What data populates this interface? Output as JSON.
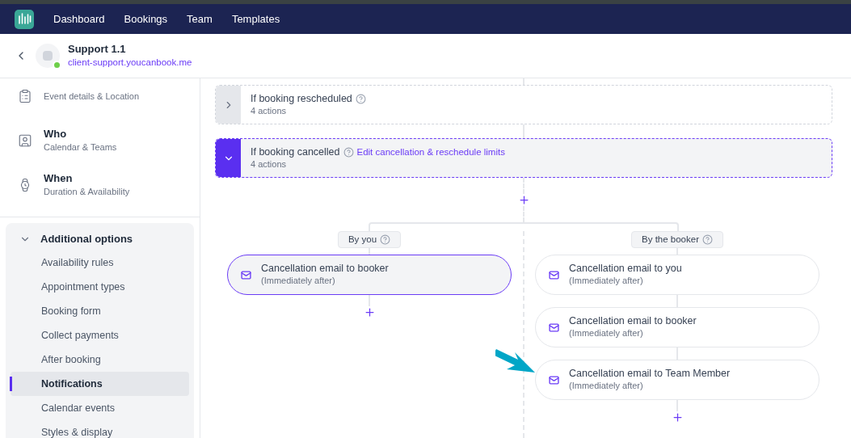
{
  "nav": {
    "items": [
      {
        "label": "Dashboard"
      },
      {
        "label": "Bookings"
      },
      {
        "label": "Team"
      },
      {
        "label": "Templates"
      }
    ]
  },
  "header": {
    "title": "Support 1.1",
    "url": "client-support.youcanbook.me",
    "online": true
  },
  "sidebar": {
    "sections": [
      {
        "kind": "what",
        "subtitle": "Event details & Location"
      },
      {
        "kind": "who",
        "title": "Who",
        "subtitle": "Calendar & Teams"
      },
      {
        "kind": "when",
        "title": "When",
        "subtitle": "Duration & Availability"
      }
    ],
    "group": {
      "title": "Additional options",
      "expanded": true,
      "items": [
        {
          "label": "Availability rules",
          "selected": false
        },
        {
          "label": "Appointment types",
          "selected": false
        },
        {
          "label": "Booking form",
          "selected": false
        },
        {
          "label": "Collect payments",
          "selected": false
        },
        {
          "label": "After booking",
          "selected": false
        },
        {
          "label": "Notifications",
          "selected": true
        },
        {
          "label": "Calendar events",
          "selected": false
        },
        {
          "label": "Styles & display",
          "selected": false
        }
      ]
    }
  },
  "triggers": [
    {
      "title": "If booking rescheduled",
      "actions": "4 actions",
      "expanded": false
    },
    {
      "title": "If booking cancelled",
      "link": "Edit cancellation & reschedule limits",
      "actions": "4 actions",
      "expanded": true
    }
  ],
  "branches": [
    {
      "label": "By you",
      "actions": [
        {
          "title": "Cancellation email to booker",
          "timing": "(Immediately after)",
          "selected": true
        }
      ]
    },
    {
      "label": "By the booker",
      "actions": [
        {
          "title": "Cancellation email to you",
          "timing": "(Immediately after)",
          "selected": false
        },
        {
          "title": "Cancellation email to booker",
          "timing": "(Immediately after)",
          "selected": false
        },
        {
          "title": "Cancellation email to Team Member",
          "timing": "(Immediately after)",
          "selected": false,
          "pointed": true
        }
      ]
    }
  ]
}
